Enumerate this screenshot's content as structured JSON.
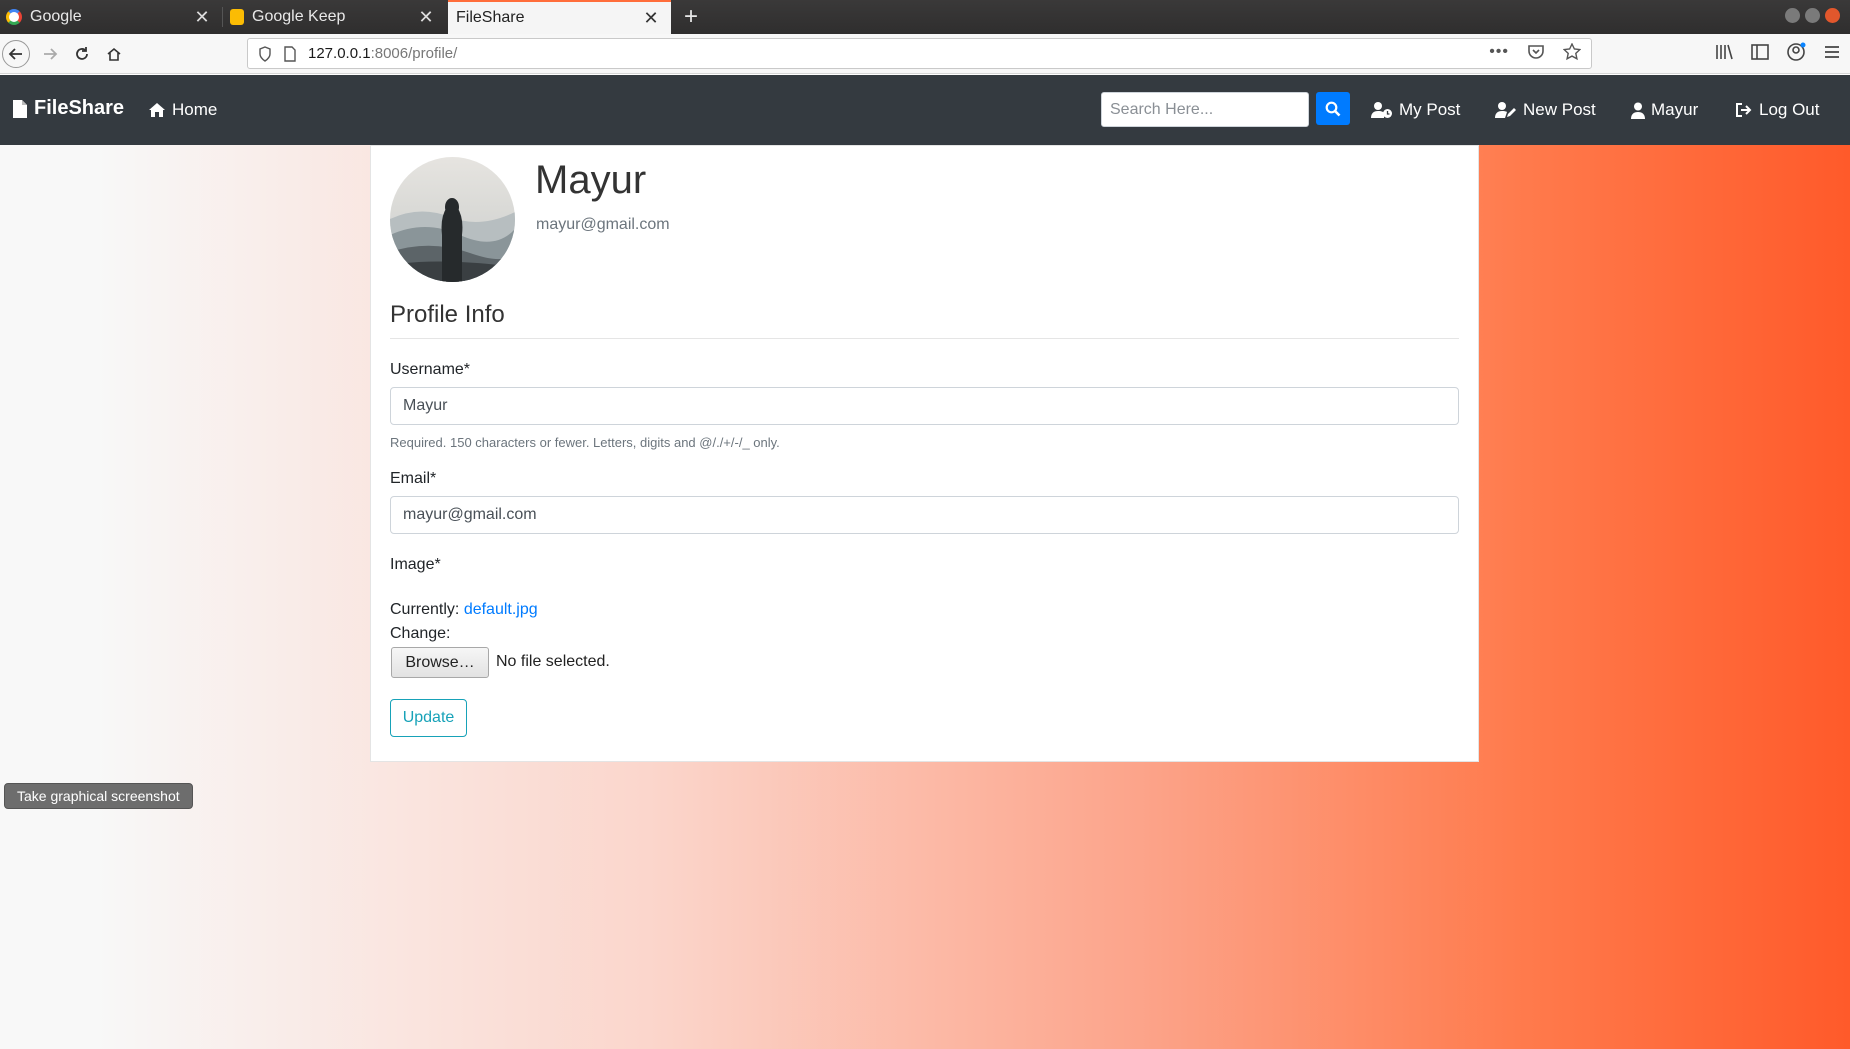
{
  "browser": {
    "tabs": [
      {
        "title": "Google",
        "icon": "google-favicon",
        "active": false
      },
      {
        "title": "Google Keep",
        "icon": "keep-favicon",
        "active": false
      },
      {
        "title": "FileShare",
        "icon": "none",
        "active": true
      }
    ],
    "url_host": "127.0.0.1",
    "url_path": ":8006/profile/"
  },
  "nav": {
    "brand": "FileShare",
    "home": "Home",
    "search_placeholder": "Search Here...",
    "my_post": "My Post",
    "new_post": "New Post",
    "user": "Mayur",
    "logout": "Log Out",
    "bg_color": "#343a40",
    "search_btn_color": "#007bff"
  },
  "profile": {
    "name": "Mayur",
    "email": "mayur@gmail.com"
  },
  "form": {
    "legend": "Profile Info",
    "username_label": "Username*",
    "username_value": "Mayur",
    "username_help": "Required. 150 characters or fewer. Letters, digits and @/./+/-/_ only.",
    "email_label": "Email*",
    "email_value": "mayur@gmail.com",
    "image_label": "Image*",
    "currently_label": "Currently:",
    "current_file": "default.jpg",
    "change_label": "Change:",
    "browse_label": "Browse…",
    "no_file": "No file selected.",
    "submit": "Update"
  },
  "tooltip": "Take graphical screenshot"
}
